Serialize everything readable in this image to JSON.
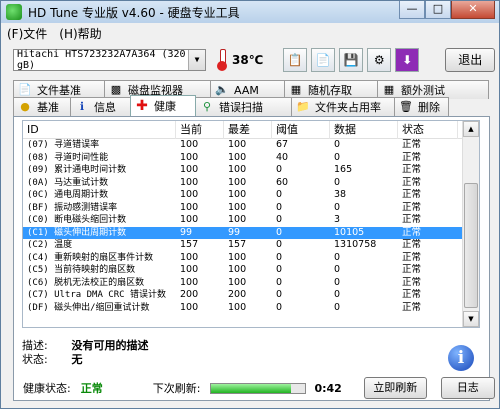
{
  "window": {
    "title": "HD Tune 专业版 v4.60 - 硬盘专业工具"
  },
  "menu": [
    "(F)文件",
    "(H)帮助"
  ],
  "toolbar": {
    "drive": "Hitachi HTS723232A7A364 (320 gB)",
    "temperature": "38℃",
    "exit_label": "退出",
    "icons": [
      "copy-info-icon",
      "copy-screen-icon",
      "save-icon",
      "options-icon",
      "download-icon"
    ]
  },
  "tabs_top": [
    {
      "label": "文件基准",
      "icon": "file-icon"
    },
    {
      "label": "磁盘监视器",
      "icon": "chart-icon"
    },
    {
      "label": "AAM",
      "icon": "speaker-icon"
    },
    {
      "label": "随机存取",
      "icon": "random-icon"
    },
    {
      "label": "额外测试",
      "icon": "test-icon"
    }
  ],
  "tabs_bottom": [
    {
      "label": "基准",
      "icon": "bulb-icon"
    },
    {
      "label": "信息",
      "icon": "info-icon"
    },
    {
      "label": "健康",
      "icon": "cross-icon",
      "active": true
    },
    {
      "label": "错误扫描",
      "icon": "magnifier-icon"
    },
    {
      "label": "文件夹占用率",
      "icon": "folder-icon"
    },
    {
      "label": "删除",
      "icon": "trash-icon"
    }
  ],
  "table": {
    "headers": [
      "ID",
      "当前",
      "最差",
      "阈值",
      "数据",
      "状态"
    ],
    "rows": [
      {
        "id": "(07) 寻道错误率",
        "cur": "100",
        "worst": "100",
        "thr": "67",
        "data": "0",
        "status": "正常"
      },
      {
        "id": "(08) 寻道时间性能",
        "cur": "100",
        "worst": "100",
        "thr": "40",
        "data": "0",
        "status": "正常"
      },
      {
        "id": "(09) 累计通电时间计数",
        "cur": "100",
        "worst": "100",
        "thr": "0",
        "data": "165",
        "status": "正常"
      },
      {
        "id": "(0A) 马达重试计数",
        "cur": "100",
        "worst": "100",
        "thr": "60",
        "data": "0",
        "status": "正常"
      },
      {
        "id": "(0C) 通电周期计数",
        "cur": "100",
        "worst": "100",
        "thr": "0",
        "data": "38",
        "status": "正常"
      },
      {
        "id": "(BF) 振动感测错误率",
        "cur": "100",
        "worst": "100",
        "thr": "0",
        "data": "0",
        "status": "正常"
      },
      {
        "id": "(C0) 断电磁头缩回计数",
        "cur": "100",
        "worst": "100",
        "thr": "0",
        "data": "3",
        "status": "正常"
      },
      {
        "id": "(C1) 磁头伸出周期计数",
        "cur": "99",
        "worst": "99",
        "thr": "0",
        "data": "10105",
        "status": "正常",
        "selected": true
      },
      {
        "id": "(C2) 温度",
        "cur": "157",
        "worst": "157",
        "thr": "0",
        "data": "1310758",
        "status": "正常"
      },
      {
        "id": "(C4) 重新映射的扇区事件计数",
        "cur": "100",
        "worst": "100",
        "thr": "0",
        "data": "0",
        "status": "正常"
      },
      {
        "id": "(C5) 当前待映射的扇区数",
        "cur": "100",
        "worst": "100",
        "thr": "0",
        "data": "0",
        "status": "正常"
      },
      {
        "id": "(C6) 脱机无法校正的扇区数",
        "cur": "100",
        "worst": "100",
        "thr": "0",
        "data": "0",
        "status": "正常"
      },
      {
        "id": "(C7) Ultra DMA CRC 错误计数",
        "cur": "200",
        "worst": "200",
        "thr": "0",
        "data": "0",
        "status": "正常"
      },
      {
        "id": "(DF) 磁头伸出/缩回重试计数",
        "cur": "100",
        "worst": "100",
        "thr": "0",
        "data": "0",
        "status": "正常"
      }
    ]
  },
  "description": {
    "label": "描述:",
    "value": "没有可用的描述"
  },
  "state": {
    "label": "状态:",
    "value": "无"
  },
  "status_bar": {
    "health_label": "健康状态:",
    "health_value": "正常",
    "next_refresh_label": "下次刷新:",
    "progress": 0.85,
    "timer": "0:42",
    "refresh_button": "立即刷新",
    "log_button": "日志"
  }
}
